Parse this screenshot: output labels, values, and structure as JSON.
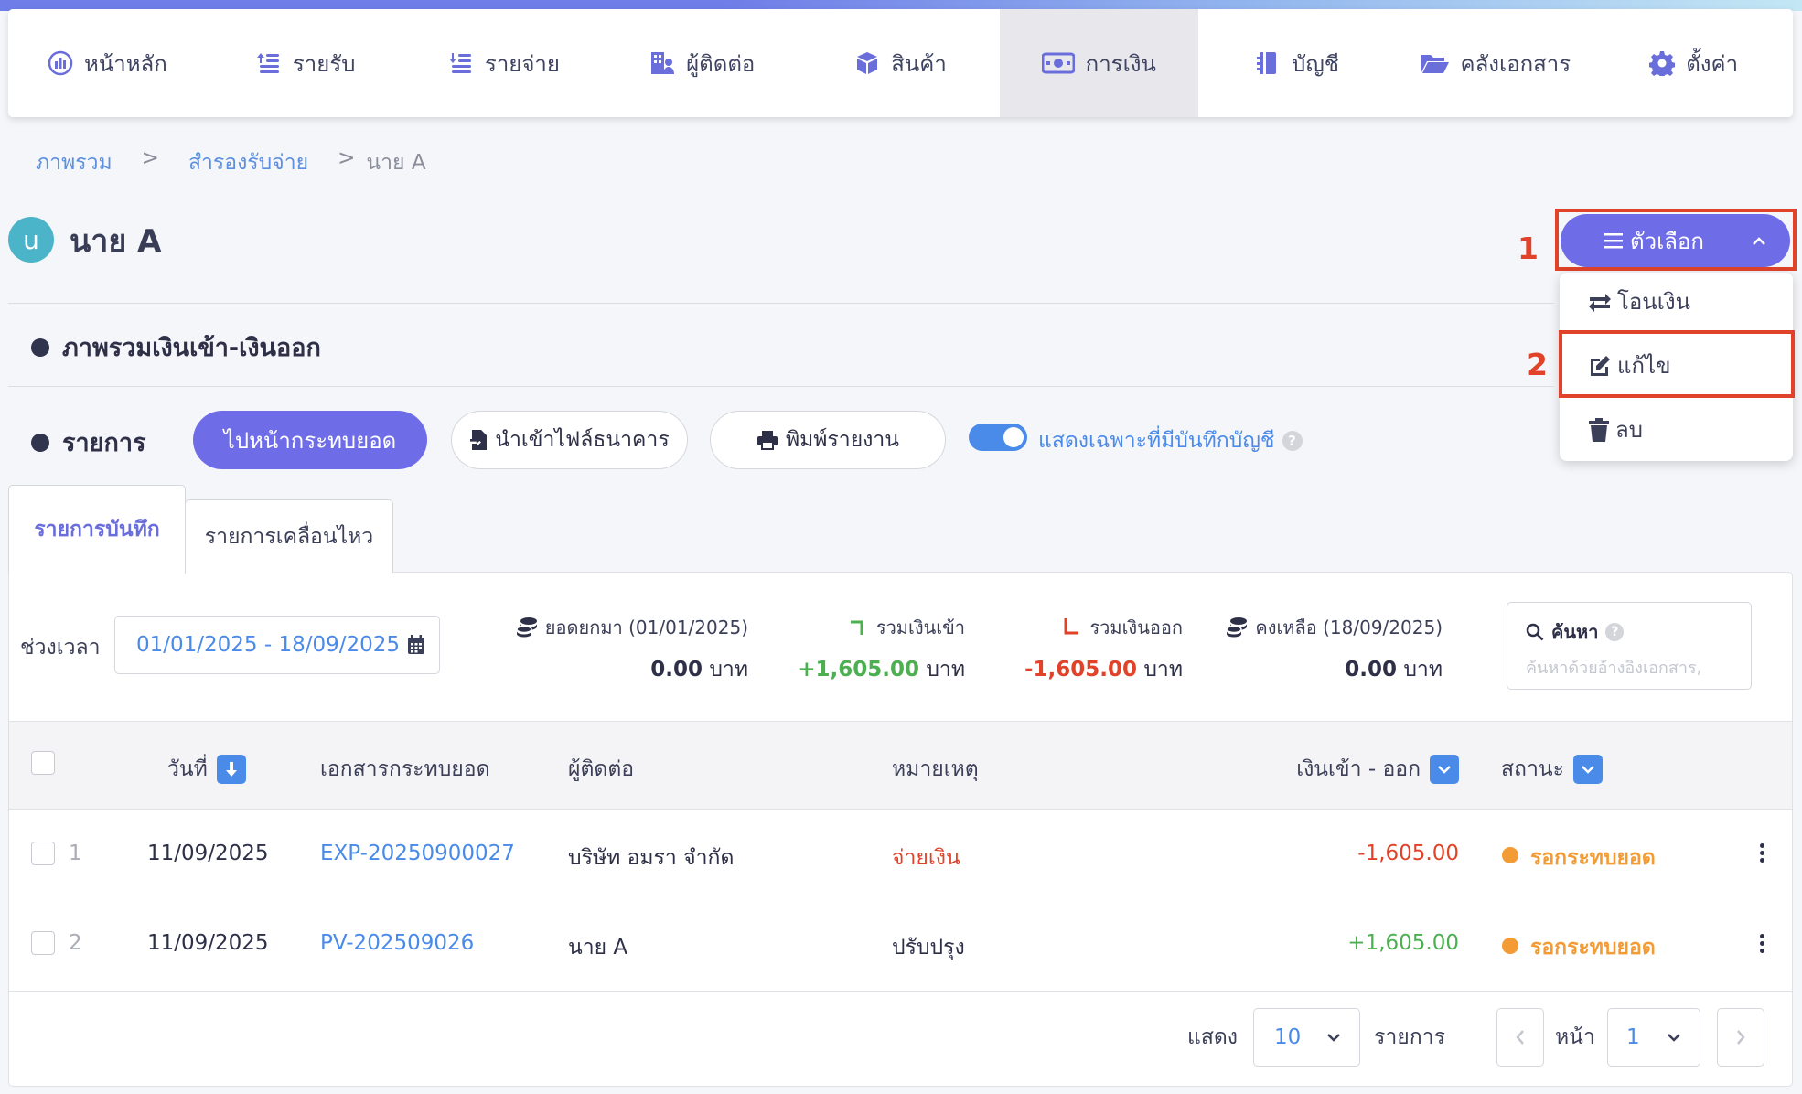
{
  "nav": {
    "items": [
      {
        "label": "หน้าหลัก",
        "icon": "dashboard-icon"
      },
      {
        "label": "รายรับ",
        "icon": "income-icon"
      },
      {
        "label": "รายจ่าย",
        "icon": "expense-icon"
      },
      {
        "label": "ผู้ติดต่อ",
        "icon": "contacts-icon"
      },
      {
        "label": "สินค้า",
        "icon": "product-box-icon"
      },
      {
        "label": "การเงิน",
        "icon": "money-icon",
        "active": true
      },
      {
        "label": "บัญชี",
        "icon": "ledger-icon"
      },
      {
        "label": "คลังเอกสาร",
        "icon": "folder-icon"
      },
      {
        "label": "ตั้งค่า",
        "icon": "gear-icon"
      }
    ]
  },
  "breadcrumb": {
    "items": [
      "ภาพรวม",
      "สำรองรับจ่าย",
      "นาย A"
    ],
    "separator": ">"
  },
  "page": {
    "avatar_letter": "u",
    "title": "นาย A"
  },
  "options": {
    "button_label": "ตัวเลือก",
    "menu": [
      {
        "label": "โอนเงิน",
        "icon": "transfer-icon"
      },
      {
        "label": "แก้ไข",
        "icon": "edit-icon"
      },
      {
        "label": "ลบ",
        "icon": "trash-icon"
      }
    ]
  },
  "annotations": {
    "step1": "1",
    "step2": "2"
  },
  "sections": {
    "overview": "ภาพรวมเงินเข้า-เงินออก",
    "transactions": "รายการ"
  },
  "actions": {
    "reconcile": "ไปหน้ากระทบยอด",
    "import_bank": "นำเข้าไฟล์ธนาคาร",
    "print_report": "พิมพ์รายงาน",
    "toggle_label": "แสดงเฉพาะที่มีบันทึกบัญชี",
    "toggle_on": true
  },
  "tabs": {
    "recorded": "รายการบันทึก",
    "movements": "รายการเคลื่อนไหว"
  },
  "filter": {
    "period_label": "ช่วงเวลา",
    "date_range": "01/01/2025 - 18/09/2025",
    "search_label": "ค้นหา",
    "search_placeholder": "ค้นหาด้วยอ้างอิงเอกสาร,"
  },
  "summary": {
    "opening": {
      "label": "ยอดยกมา (01/01/2025)",
      "value": "0.00",
      "unit": "บาท"
    },
    "money_in": {
      "label": "รวมเงินเข้า",
      "value": "+1,605.00",
      "unit": "บาท"
    },
    "money_out": {
      "label": "รวมเงินออก",
      "value": "-1,605.00",
      "unit": "บาท"
    },
    "balance": {
      "label": "คงเหลือ (18/09/2025)",
      "value": "0.00",
      "unit": "บาท"
    }
  },
  "table": {
    "columns": {
      "date": "วันที่",
      "doc": "เอกสารกระทบยอด",
      "contact": "ผู้ติดต่อ",
      "note": "หมายเหตุ",
      "amount": "เงินเข้า - ออก",
      "status": "สถานะ"
    },
    "rows": [
      {
        "no": "1",
        "date": "11/09/2025",
        "doc": "EXP-20250900027",
        "contact": "บริษัท อมรา จำกัด",
        "note": "จ่ายเงิน",
        "amount": "-1,605.00",
        "status": "รอกระทบยอด"
      },
      {
        "no": "2",
        "date": "11/09/2025",
        "doc": "PV-202509026",
        "contact": "นาย A",
        "note": "ปรับปรุง",
        "amount": "+1,605.00",
        "status": "รอกระทบยอด"
      }
    ]
  },
  "pagination": {
    "show_label": "แสดง",
    "page_size": "10",
    "items_label": "รายการ",
    "page_label": "หน้า",
    "page": "1"
  },
  "colors": {
    "accent": "#6f6ce8",
    "link": "#4a8ae8",
    "positive": "#4caf50",
    "negative": "#e0432a",
    "pending": "#f39c35",
    "highlight": "#e0432a"
  }
}
